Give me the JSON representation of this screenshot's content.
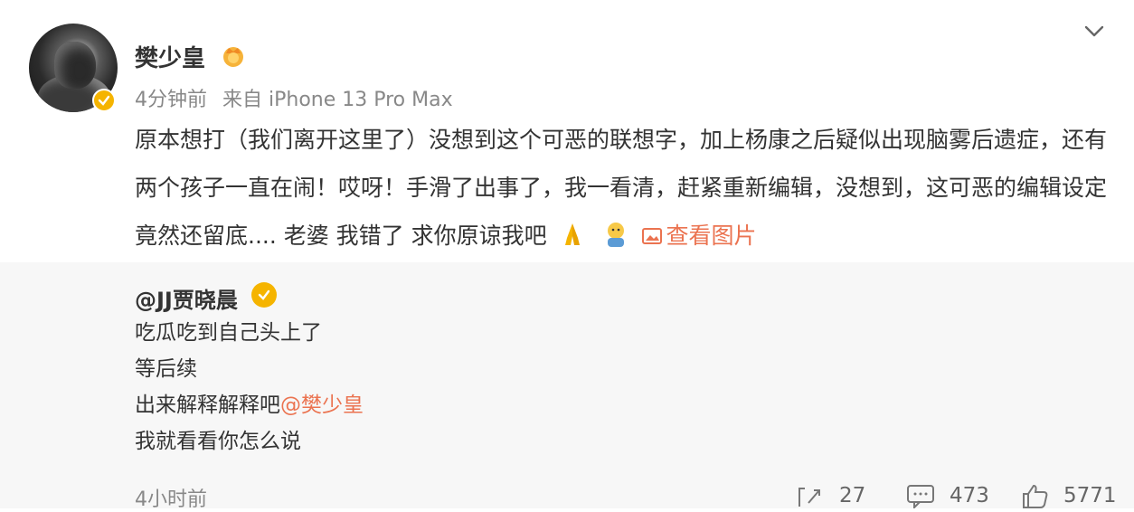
{
  "post": {
    "username": "樊少皇",
    "time": "4分钟前",
    "source": "来自 iPhone 13 Pro Max",
    "text_before_emoji": "原本想打（我们离开这里了）没想到这个可恶的联想字，加上杨康之后疑似出现脑雾后遗症，还有两个孩子一直在闹！哎呀！手滑了出事了，我一看清，赶紧重新编辑，没想到，这可恶的编辑设定竟然还留底.... 老婆 我错了 求你原谅我吧",
    "emoji_1": "pray-emoji",
    "emoji_2": "hug-emoji",
    "view_pictures": "查看图片"
  },
  "repost": {
    "username": "@JJ贾晓晨",
    "lines": [
      "吃瓜吃到自己头上了",
      "等后续",
      "出来解释解释吧"
    ],
    "mention": "@樊少皇",
    "last_line": "我就看看你怎么说",
    "time": "4小时前"
  },
  "actions": {
    "repost_count": "27",
    "comment_count": "473",
    "like_count": "5771"
  },
  "colors": {
    "accent": "#eb7350",
    "badge": "#f5b400",
    "repost_bg": "#f7f7f7"
  }
}
